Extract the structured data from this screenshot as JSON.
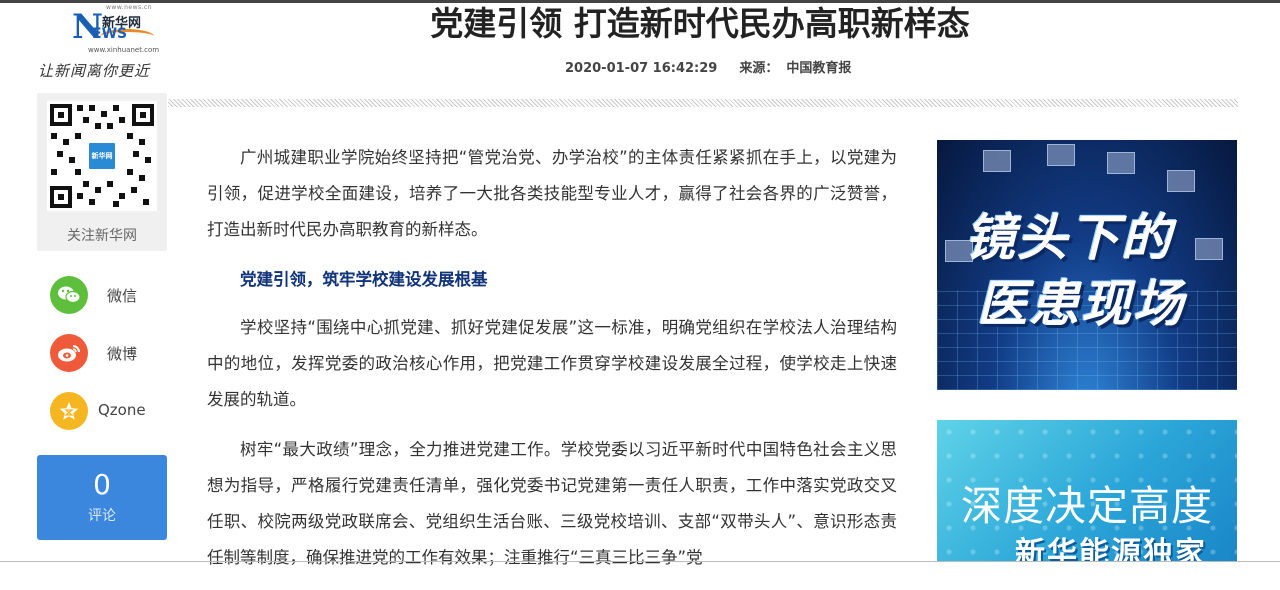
{
  "brand": {
    "url_top": "www.news.cn",
    "logo_latin": "N",
    "logo_latin_small": "EWS",
    "logo_cn": "新华网",
    "logo_url": "www.xinhuanet.com",
    "slogan": "让新闻离你更近"
  },
  "article": {
    "title": "党建引领 打造新时代民办高职新样态",
    "datetime": "2020-01-07 16:42:29",
    "source_label": "来源：",
    "source": "中国教育报",
    "paragraphs": [
      "广州城建职业学院始终坚持把“管党治党、办学治校”的主体责任紧紧抓在手上，以党建为引领，促进学校全面建设，培养了一大批各类技能型专业人才，赢得了社会各界的广泛赞誉，打造出新时代民办高职教育的新样态。",
      "党建引领，筑牢学校建设发展根基",
      "学校坚持“围绕中心抓党建、抓好党建促发展”这一标准，明确党组织在学校法人治理结构中的地位，发挥党委的政治核心作用，把党建工作贯穿学校建设发展全过程，使学校走上快速发展的轨道。",
      "树牢“最大政绩”理念，全力推进党建工作。学校党委以习近平新时代中国特色社会主义思想为指导，严格履行党建责任清单，强化党委书记党建第一责任人职责，工作中落实党政交叉任职、校院两级党政联席会、党组织生活台账、三级党校培训、支部“双带头人”、意识形态责任制等制度，确保推进党的工作有效果；注重推行“三真三比三争”党"
    ]
  },
  "sidebar": {
    "qr_center_text": "新华网",
    "qr_label": "关注新华网",
    "share": [
      {
        "label": "微信",
        "color": "#5dbf3b",
        "icon": "wechat-icon"
      },
      {
        "label": "微博",
        "color": "#ef5a3a",
        "icon": "weibo-icon"
      },
      {
        "label": "Qzone",
        "color": "#f6b621",
        "icon": "qzone-icon"
      }
    ],
    "comment_count": "0",
    "comment_label": "评论"
  },
  "banners": {
    "b1_line1": "镜头下的",
    "b1_line2": "医患现场",
    "b2_line1": "深度决定高度",
    "b2_line2": "新华能源独家"
  }
}
